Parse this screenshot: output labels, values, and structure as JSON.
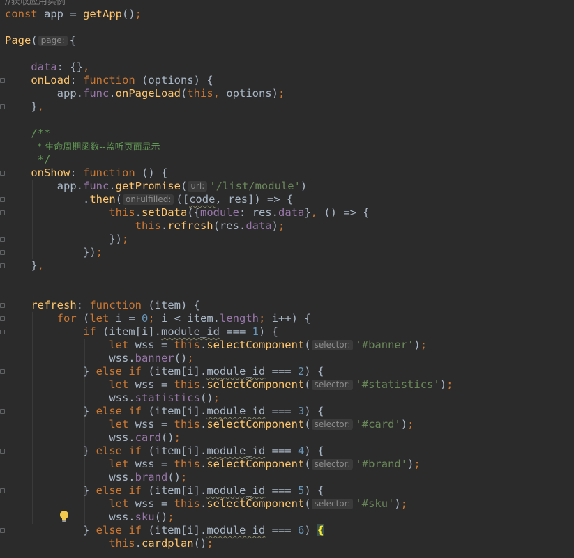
{
  "editor": {
    "lines": [
      [
        {
          "t": "//获取应用实例",
          "c": "comment"
        }
      ],
      [
        {
          "t": "const ",
          "c": "keyword"
        },
        {
          "t": "app = ",
          "c": "code"
        },
        {
          "t": "getApp",
          "c": "func"
        },
        {
          "t": "()",
          "c": "punct"
        },
        {
          "t": ";",
          "c": "keyword"
        }
      ],
      [],
      [
        {
          "t": "Page",
          "c": "func"
        },
        {
          "t": "(",
          "c": "punct"
        },
        {
          "t": "page:",
          "c": "hint"
        },
        {
          "t": "{",
          "c": "punct"
        }
      ],
      [],
      [
        {
          "t": "    "
        },
        {
          "t": "data",
          "c": "prop"
        },
        {
          "t": ": {}",
          "c": "code"
        },
        {
          "t": ",",
          "c": "keyword"
        }
      ],
      [
        {
          "t": "    "
        },
        {
          "t": "onLoad",
          "c": "func"
        },
        {
          "t": ": ",
          "c": "code"
        },
        {
          "t": "function ",
          "c": "keyword"
        },
        {
          "t": "(options) {",
          "c": "code"
        }
      ],
      [
        {
          "t": "        "
        },
        {
          "t": "app.",
          "c": "code"
        },
        {
          "t": "func",
          "c": "prop"
        },
        {
          "t": ".",
          "c": "code"
        },
        {
          "t": "onPageLoad",
          "c": "func"
        },
        {
          "t": "(",
          "c": "code"
        },
        {
          "t": "this",
          "c": "keyword"
        },
        {
          "t": ", ",
          "c": "keyword"
        },
        {
          "t": "options)",
          "c": "code"
        },
        {
          "t": ";",
          "c": "keyword"
        }
      ],
      [
        {
          "t": "    "
        },
        {
          "t": "}",
          "c": "code"
        },
        {
          "t": ",",
          "c": "keyword"
        }
      ],
      [],
      [
        {
          "t": "    "
        },
        {
          "t": "/**",
          "c": "doc"
        }
      ],
      [
        {
          "t": "     "
        },
        {
          "t": "* 生命周期函数--监听页面显示",
          "c": "doc"
        }
      ],
      [
        {
          "t": "     "
        },
        {
          "t": "*/",
          "c": "doc"
        }
      ],
      [
        {
          "t": "    "
        },
        {
          "t": "onShow",
          "c": "func"
        },
        {
          "t": ": ",
          "c": "code"
        },
        {
          "t": "function ",
          "c": "keyword"
        },
        {
          "t": "() {",
          "c": "code"
        }
      ],
      [
        {
          "t": "        "
        },
        {
          "t": "app.",
          "c": "code"
        },
        {
          "t": "func",
          "c": "prop"
        },
        {
          "t": ".",
          "c": "code"
        },
        {
          "t": "getPromise",
          "c": "func"
        },
        {
          "t": "(",
          "c": "code"
        },
        {
          "t": "url:",
          "c": "hint"
        },
        {
          "t": "'/list/module'",
          "c": "string"
        },
        {
          "t": ")",
          "c": "code"
        }
      ],
      [
        {
          "t": "            "
        },
        {
          "t": ".",
          "c": "code"
        },
        {
          "t": "then",
          "c": "func"
        },
        {
          "t": "(",
          "c": "code"
        },
        {
          "t": "onFulfilled:",
          "c": "hint"
        },
        {
          "t": "([",
          "c": "code"
        },
        {
          "t": "code",
          "c": "code",
          "w": 1
        },
        {
          "t": ", res]) => {",
          "c": "code"
        }
      ],
      [
        {
          "t": "                "
        },
        {
          "t": "this",
          "c": "keyword"
        },
        {
          "t": ".",
          "c": "code"
        },
        {
          "t": "setData",
          "c": "func"
        },
        {
          "t": "({",
          "c": "code"
        },
        {
          "t": "module",
          "c": "prop"
        },
        {
          "t": ": res.",
          "c": "code"
        },
        {
          "t": "data",
          "c": "prop"
        },
        {
          "t": "}",
          "c": "code"
        },
        {
          "t": ", ",
          "c": "keyword"
        },
        {
          "t": "() => {",
          "c": "code"
        }
      ],
      [
        {
          "t": "                    "
        },
        {
          "t": "this",
          "c": "keyword"
        },
        {
          "t": ".",
          "c": "code"
        },
        {
          "t": "refresh",
          "c": "func"
        },
        {
          "t": "(res.",
          "c": "code"
        },
        {
          "t": "data",
          "c": "prop"
        },
        {
          "t": ")",
          "c": "code"
        },
        {
          "t": ";",
          "c": "keyword"
        }
      ],
      [
        {
          "t": "                "
        },
        {
          "t": "})",
          "c": "code"
        },
        {
          "t": ";",
          "c": "keyword"
        }
      ],
      [
        {
          "t": "            "
        },
        {
          "t": "})",
          "c": "code"
        },
        {
          "t": ";",
          "c": "keyword"
        }
      ],
      [
        {
          "t": "    "
        },
        {
          "t": "}",
          "c": "code"
        },
        {
          "t": ",",
          "c": "keyword"
        }
      ],
      [],
      [],
      [
        {
          "t": "    "
        },
        {
          "t": "refresh",
          "c": "func"
        },
        {
          "t": ": ",
          "c": "code"
        },
        {
          "t": "function ",
          "c": "keyword"
        },
        {
          "t": "(item) {",
          "c": "code"
        }
      ],
      [
        {
          "t": "        "
        },
        {
          "t": "for ",
          "c": "keyword"
        },
        {
          "t": "(",
          "c": "code"
        },
        {
          "t": "let ",
          "c": "keyword"
        },
        {
          "t": "i = ",
          "c": "code"
        },
        {
          "t": "0",
          "c": "number"
        },
        {
          "t": "; ",
          "c": "keyword"
        },
        {
          "t": "i < item.",
          "c": "code"
        },
        {
          "t": "length",
          "c": "prop"
        },
        {
          "t": "; ",
          "c": "keyword"
        },
        {
          "t": "i++) {",
          "c": "code"
        }
      ],
      [
        {
          "t": "            "
        },
        {
          "t": "if ",
          "c": "keyword"
        },
        {
          "t": "(item[i].",
          "c": "code"
        },
        {
          "t": "module_id",
          "c": "code",
          "w": 1
        },
        {
          "t": " === ",
          "c": "code"
        },
        {
          "t": "1",
          "c": "number"
        },
        {
          "t": ") {",
          "c": "code"
        }
      ],
      [
        {
          "t": "                "
        },
        {
          "t": "let ",
          "c": "keyword"
        },
        {
          "t": "wss = ",
          "c": "code"
        },
        {
          "t": "this",
          "c": "keyword"
        },
        {
          "t": ".",
          "c": "code"
        },
        {
          "t": "selectComponent",
          "c": "func"
        },
        {
          "t": "(",
          "c": "code"
        },
        {
          "t": "selector:",
          "c": "hint"
        },
        {
          "t": "'#banner'",
          "c": "string"
        },
        {
          "t": ")",
          "c": "code"
        },
        {
          "t": ";",
          "c": "keyword"
        }
      ],
      [
        {
          "t": "                "
        },
        {
          "t": "wss.",
          "c": "code"
        },
        {
          "t": "banner",
          "c": "prop"
        },
        {
          "t": "()",
          "c": "code"
        },
        {
          "t": ";",
          "c": "keyword"
        }
      ],
      [
        {
          "t": "            "
        },
        {
          "t": "} ",
          "c": "code"
        },
        {
          "t": "else if ",
          "c": "keyword"
        },
        {
          "t": "(item[i].",
          "c": "code"
        },
        {
          "t": "module_id",
          "c": "code",
          "w": 1
        },
        {
          "t": " === ",
          "c": "code"
        },
        {
          "t": "2",
          "c": "number"
        },
        {
          "t": ") {",
          "c": "code"
        }
      ],
      [
        {
          "t": "                "
        },
        {
          "t": "let ",
          "c": "keyword"
        },
        {
          "t": "wss = ",
          "c": "code"
        },
        {
          "t": "this",
          "c": "keyword"
        },
        {
          "t": ".",
          "c": "code"
        },
        {
          "t": "selectComponent",
          "c": "func"
        },
        {
          "t": "(",
          "c": "code"
        },
        {
          "t": "selector:",
          "c": "hint"
        },
        {
          "t": "'#statistics'",
          "c": "string"
        },
        {
          "t": ")",
          "c": "code"
        },
        {
          "t": ";",
          "c": "keyword"
        }
      ],
      [
        {
          "t": "                "
        },
        {
          "t": "wss.",
          "c": "code"
        },
        {
          "t": "statistics",
          "c": "prop"
        },
        {
          "t": "()",
          "c": "code"
        },
        {
          "t": ";",
          "c": "keyword"
        }
      ],
      [
        {
          "t": "            "
        },
        {
          "t": "} ",
          "c": "code"
        },
        {
          "t": "else if ",
          "c": "keyword"
        },
        {
          "t": "(item[i].",
          "c": "code"
        },
        {
          "t": "module_id",
          "c": "code",
          "w": 1
        },
        {
          "t": " === ",
          "c": "code"
        },
        {
          "t": "3",
          "c": "number"
        },
        {
          "t": ") {",
          "c": "code"
        }
      ],
      [
        {
          "t": "                "
        },
        {
          "t": "let ",
          "c": "keyword"
        },
        {
          "t": "wss = ",
          "c": "code"
        },
        {
          "t": "this",
          "c": "keyword"
        },
        {
          "t": ".",
          "c": "code"
        },
        {
          "t": "selectComponent",
          "c": "func"
        },
        {
          "t": "(",
          "c": "code"
        },
        {
          "t": "selector:",
          "c": "hint"
        },
        {
          "t": "'#card'",
          "c": "string"
        },
        {
          "t": ")",
          "c": "code"
        },
        {
          "t": ";",
          "c": "keyword"
        }
      ],
      [
        {
          "t": "                "
        },
        {
          "t": "wss.",
          "c": "code"
        },
        {
          "t": "card",
          "c": "prop"
        },
        {
          "t": "()",
          "c": "code"
        },
        {
          "t": ";",
          "c": "keyword"
        }
      ],
      [
        {
          "t": "            "
        },
        {
          "t": "} ",
          "c": "code"
        },
        {
          "t": "else if ",
          "c": "keyword"
        },
        {
          "t": "(item[i].",
          "c": "code"
        },
        {
          "t": "module_id",
          "c": "code",
          "w": 1
        },
        {
          "t": " === ",
          "c": "code"
        },
        {
          "t": "4",
          "c": "number"
        },
        {
          "t": ") {",
          "c": "code"
        }
      ],
      [
        {
          "t": "                "
        },
        {
          "t": "let ",
          "c": "keyword"
        },
        {
          "t": "wss = ",
          "c": "code"
        },
        {
          "t": "this",
          "c": "keyword"
        },
        {
          "t": ".",
          "c": "code"
        },
        {
          "t": "selectComponent",
          "c": "func"
        },
        {
          "t": "(",
          "c": "code"
        },
        {
          "t": "selector:",
          "c": "hint"
        },
        {
          "t": "'#brand'",
          "c": "string"
        },
        {
          "t": ")",
          "c": "code"
        },
        {
          "t": ";",
          "c": "keyword"
        }
      ],
      [
        {
          "t": "                "
        },
        {
          "t": "wss.",
          "c": "code"
        },
        {
          "t": "brand",
          "c": "prop"
        },
        {
          "t": "()",
          "c": "code"
        },
        {
          "t": ";",
          "c": "keyword"
        }
      ],
      [
        {
          "t": "            "
        },
        {
          "t": "} ",
          "c": "code"
        },
        {
          "t": "else if ",
          "c": "keyword"
        },
        {
          "t": "(item[i].",
          "c": "code"
        },
        {
          "t": "module_id",
          "c": "code",
          "w": 1
        },
        {
          "t": " === ",
          "c": "code"
        },
        {
          "t": "5",
          "c": "number"
        },
        {
          "t": ") {",
          "c": "code"
        }
      ],
      [
        {
          "t": "                "
        },
        {
          "t": "let ",
          "c": "keyword"
        },
        {
          "t": "wss = ",
          "c": "code"
        },
        {
          "t": "this",
          "c": "keyword"
        },
        {
          "t": ".",
          "c": "code"
        },
        {
          "t": "selectComponent",
          "c": "func"
        },
        {
          "t": "(",
          "c": "code"
        },
        {
          "t": "selector:",
          "c": "hint"
        },
        {
          "t": "'#sku'",
          "c": "string"
        },
        {
          "t": ")",
          "c": "code"
        },
        {
          "t": ";",
          "c": "keyword"
        }
      ],
      [
        {
          "t": "                "
        },
        {
          "t": "wss.",
          "c": "code"
        },
        {
          "t": "sku",
          "c": "prop"
        },
        {
          "t": "()",
          "c": "code"
        },
        {
          "t": ";",
          "c": "keyword"
        }
      ],
      [
        {
          "t": "            "
        },
        {
          "t": "} ",
          "c": "code"
        },
        {
          "t": "else if ",
          "c": "keyword"
        },
        {
          "t": "(item[i].",
          "c": "code"
        },
        {
          "t": "module_id",
          "c": "code",
          "w": 1
        },
        {
          "t": " === ",
          "c": "code"
        },
        {
          "t": "6",
          "c": "number"
        },
        {
          "t": ") ",
          "c": "code"
        },
        {
          "t": "{",
          "c": "brace-hl"
        }
      ],
      [
        {
          "t": "                "
        },
        {
          "t": "this",
          "c": "keyword"
        },
        {
          "t": ".",
          "c": "code"
        },
        {
          "t": "cardplan",
          "c": "func"
        },
        {
          "t": "()",
          "c": "code"
        },
        {
          "t": ";",
          "c": "keyword"
        }
      ]
    ],
    "caret_line": 39,
    "fold_markers": [
      6,
      8,
      13,
      15,
      16,
      18,
      19,
      20,
      23,
      24,
      25,
      28,
      31,
      34,
      37,
      40
    ],
    "indent_guides": [
      {
        "col": 4,
        "from": 14,
        "to": 20
      },
      {
        "col": 8,
        "from": 16,
        "to": 19
      },
      {
        "col": 4,
        "from": 24,
        "to": 40
      },
      {
        "col": 8,
        "from": 25,
        "to": 40
      },
      {
        "col": 12,
        "from": 26,
        "to": 40
      }
    ],
    "intention_icon": "lightbulb-icon"
  },
  "colors": {
    "background": "#2b2b2b",
    "caret_row": "#323232",
    "keyword": "#cc7832",
    "function": "#ffc66d",
    "property": "#9876aa",
    "string": "#6a8759",
    "number": "#6897bb",
    "doc_comment": "#629755",
    "line_comment": "#808080",
    "default": "#a9b7c6",
    "hint_background": "#3b3b3b",
    "brace_highlight": "#ffef28",
    "bulb": "#f2c94c"
  }
}
